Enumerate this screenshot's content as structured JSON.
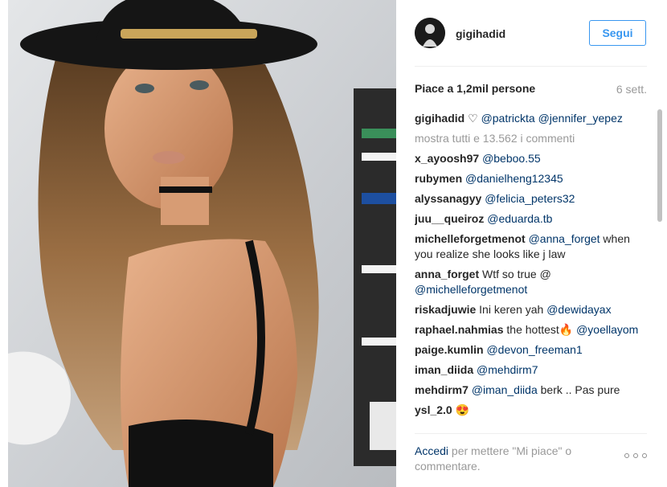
{
  "post": {
    "username": "gigihadid",
    "follow_label": "Segui",
    "likes_text": "Piace a 1,2mil persone",
    "age_text": "6 sett.",
    "caption": {
      "user": "gigihadid",
      "text": " ♡ ",
      "mentions": [
        "@patrickta",
        "@jennifer_yepez"
      ]
    },
    "show_all_text": "mostra tutti e 13.562 i commenti"
  },
  "comments": [
    {
      "user": "x_ayoosh97",
      "parts": [
        {
          "t": " "
        },
        {
          "m": "@beboo.55"
        }
      ]
    },
    {
      "user": "rubymen",
      "parts": [
        {
          "t": " "
        },
        {
          "m": "@danielheng12345"
        }
      ]
    },
    {
      "user": "alyssanagyy",
      "parts": [
        {
          "t": " "
        },
        {
          "m": "@felicia_peters32"
        }
      ]
    },
    {
      "user": "juu__queiroz",
      "parts": [
        {
          "t": " "
        },
        {
          "m": "@eduarda.tb"
        }
      ]
    },
    {
      "user": "michelleforgetmenot",
      "parts": [
        {
          "t": " "
        },
        {
          "m": "@anna_forget"
        },
        {
          "t": " when you realize she looks like j law"
        }
      ]
    },
    {
      "user": "anna_forget",
      "parts": [
        {
          "t": " Wtf so true @ "
        },
        {
          "m": "@michelleforgetmenot"
        }
      ]
    },
    {
      "user": "riskadjuwie",
      "parts": [
        {
          "t": " Ini keren yah "
        },
        {
          "m": "@dewidayax"
        }
      ]
    },
    {
      "user": "raphael.nahmias",
      "parts": [
        {
          "t": " the hottest🔥 "
        },
        {
          "m": "@yoellayom"
        }
      ]
    },
    {
      "user": "paige.kumlin",
      "parts": [
        {
          "t": " "
        },
        {
          "m": "@devon_freeman1"
        }
      ]
    },
    {
      "user": "iman_diida",
      "parts": [
        {
          "t": " "
        },
        {
          "m": "@mehdirm7"
        }
      ]
    },
    {
      "user": "mehdirm7",
      "parts": [
        {
          "t": " "
        },
        {
          "m": "@iman_diida"
        },
        {
          "t": " berk .. Pas pure"
        }
      ]
    },
    {
      "user": "ysl_2.0",
      "parts": [
        {
          "t": " 😍"
        }
      ]
    }
  ],
  "footer": {
    "login_label": "Accedi",
    "rest_text": " per mettere \"Mi piace\" o commentare."
  },
  "icons": {
    "more": "ellipsis-icon"
  },
  "colors": {
    "accent": "#3897f0",
    "link": "#003569",
    "muted": "#999999",
    "text": "#262626"
  }
}
